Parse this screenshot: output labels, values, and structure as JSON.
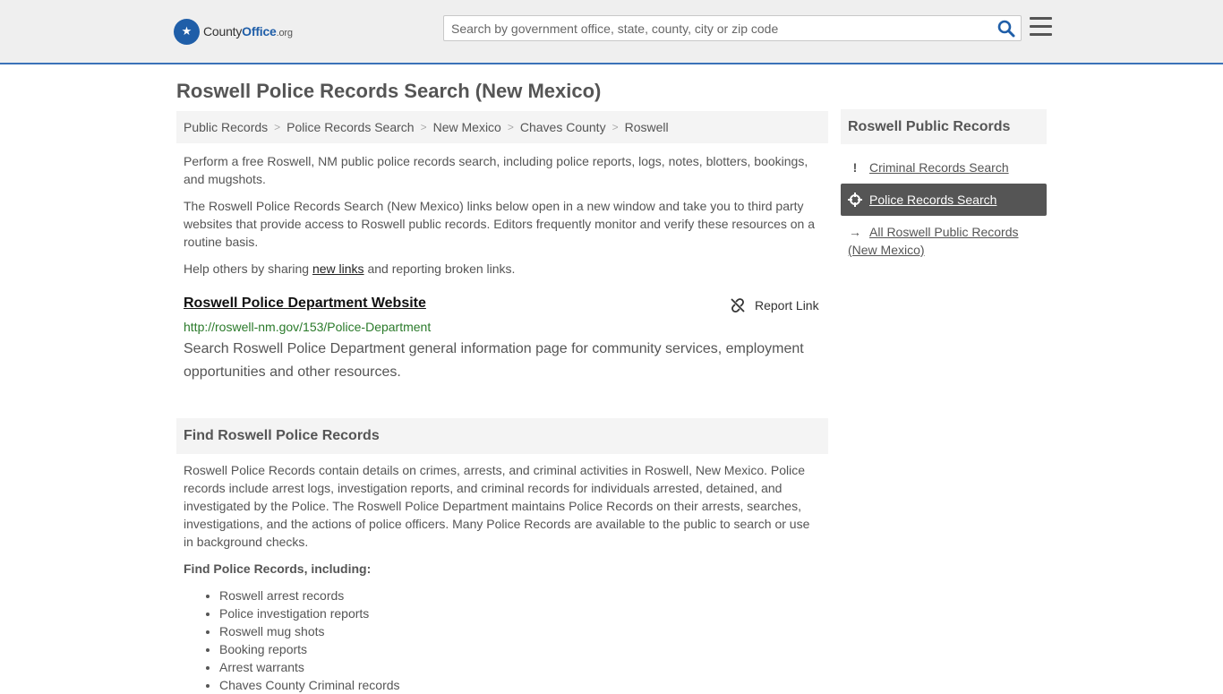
{
  "header": {
    "logo_brand": "County",
    "logo_brand_bold": "Office",
    "logo_tld": ".org",
    "search_placeholder": "Search by government office, state, county, city or zip code"
  },
  "page_title": "Roswell Police Records Search (New Mexico)",
  "breadcrumb": [
    "Public Records",
    "Police Records Search",
    "New Mexico",
    "Chaves County",
    "Roswell"
  ],
  "intro": {
    "p1": "Perform a free Roswell, NM public police records search, including police reports, logs, notes, blotters, bookings, and mugshots.",
    "p2": "The Roswell Police Records Search (New Mexico) links below open in a new window and take you to third party websites that provide access to Roswell public records. Editors frequently monitor and verify these resources on a routine basis.",
    "p3_before": "Help others by sharing ",
    "p3_link": "new links",
    "p3_after": " and reporting broken links."
  },
  "result": {
    "title": "Roswell Police Department Website",
    "report_label": "Report Link",
    "url": "http://roswell-nm.gov/153/Police-Department",
    "description": "Search Roswell Police Department general information page for community services, employment opportunities and other resources."
  },
  "find_section": {
    "heading": "Find Roswell Police Records",
    "body": "Roswell Police Records contain details on crimes, arrests, and criminal activities in Roswell, New Mexico. Police records include arrest logs, investigation reports, and criminal records for individuals arrested, detained, and investigated by the Police. The Roswell Police Department maintains Police Records on their arrests, searches, investigations, and the actions of police officers. Many Police Records are available to the public to search or use in background checks.",
    "subheading": "Find Police Records, including:",
    "items": [
      "Roswell arrest records",
      "Police investigation reports",
      "Roswell mug shots",
      "Booking reports",
      "Arrest warrants",
      "Chaves County Criminal records"
    ]
  },
  "sidebar": {
    "heading": "Roswell Public Records",
    "items": [
      {
        "label": "Criminal Records Search",
        "icon": "exclamation-icon"
      },
      {
        "label": "Police Records Search",
        "icon": "crosshair-icon"
      },
      {
        "label": "All Roswell Public Records (New Mexico)",
        "icon": "arrow-right-icon"
      }
    ]
  }
}
